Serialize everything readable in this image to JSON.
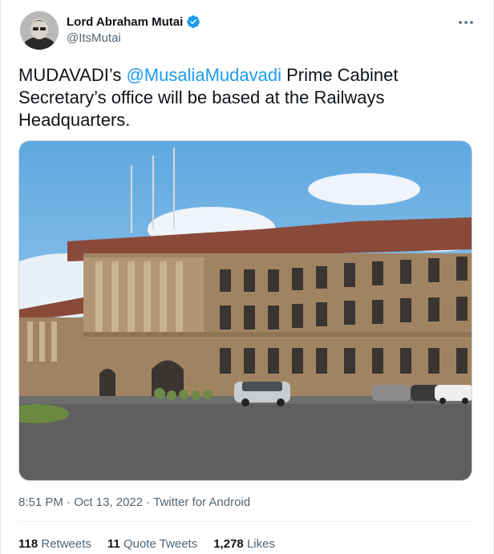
{
  "author": {
    "display_name": "Lord Abraham Mutai",
    "handle": "@ItsMutai",
    "verified": true
  },
  "tweet": {
    "text_before": "MUDAVADI’s ",
    "mention": "@MusaliaMudavadi",
    "text_after": " Prime Cabinet Secretary’s office will be based at the Railways Headquarters."
  },
  "meta": {
    "time": "8:51 PM",
    "date": "Oct 13, 2022",
    "source": "Twitter for Android",
    "separator": "·"
  },
  "stats": {
    "retweets_count": "118",
    "retweets_label": "Retweets",
    "quotes_count": "11",
    "quotes_label": "Quote Tweets",
    "likes_count": "1,278",
    "likes_label": "Likes"
  },
  "colors": {
    "accent": "#1d9bf0",
    "text": "#0f1419",
    "muted": "#536471"
  }
}
